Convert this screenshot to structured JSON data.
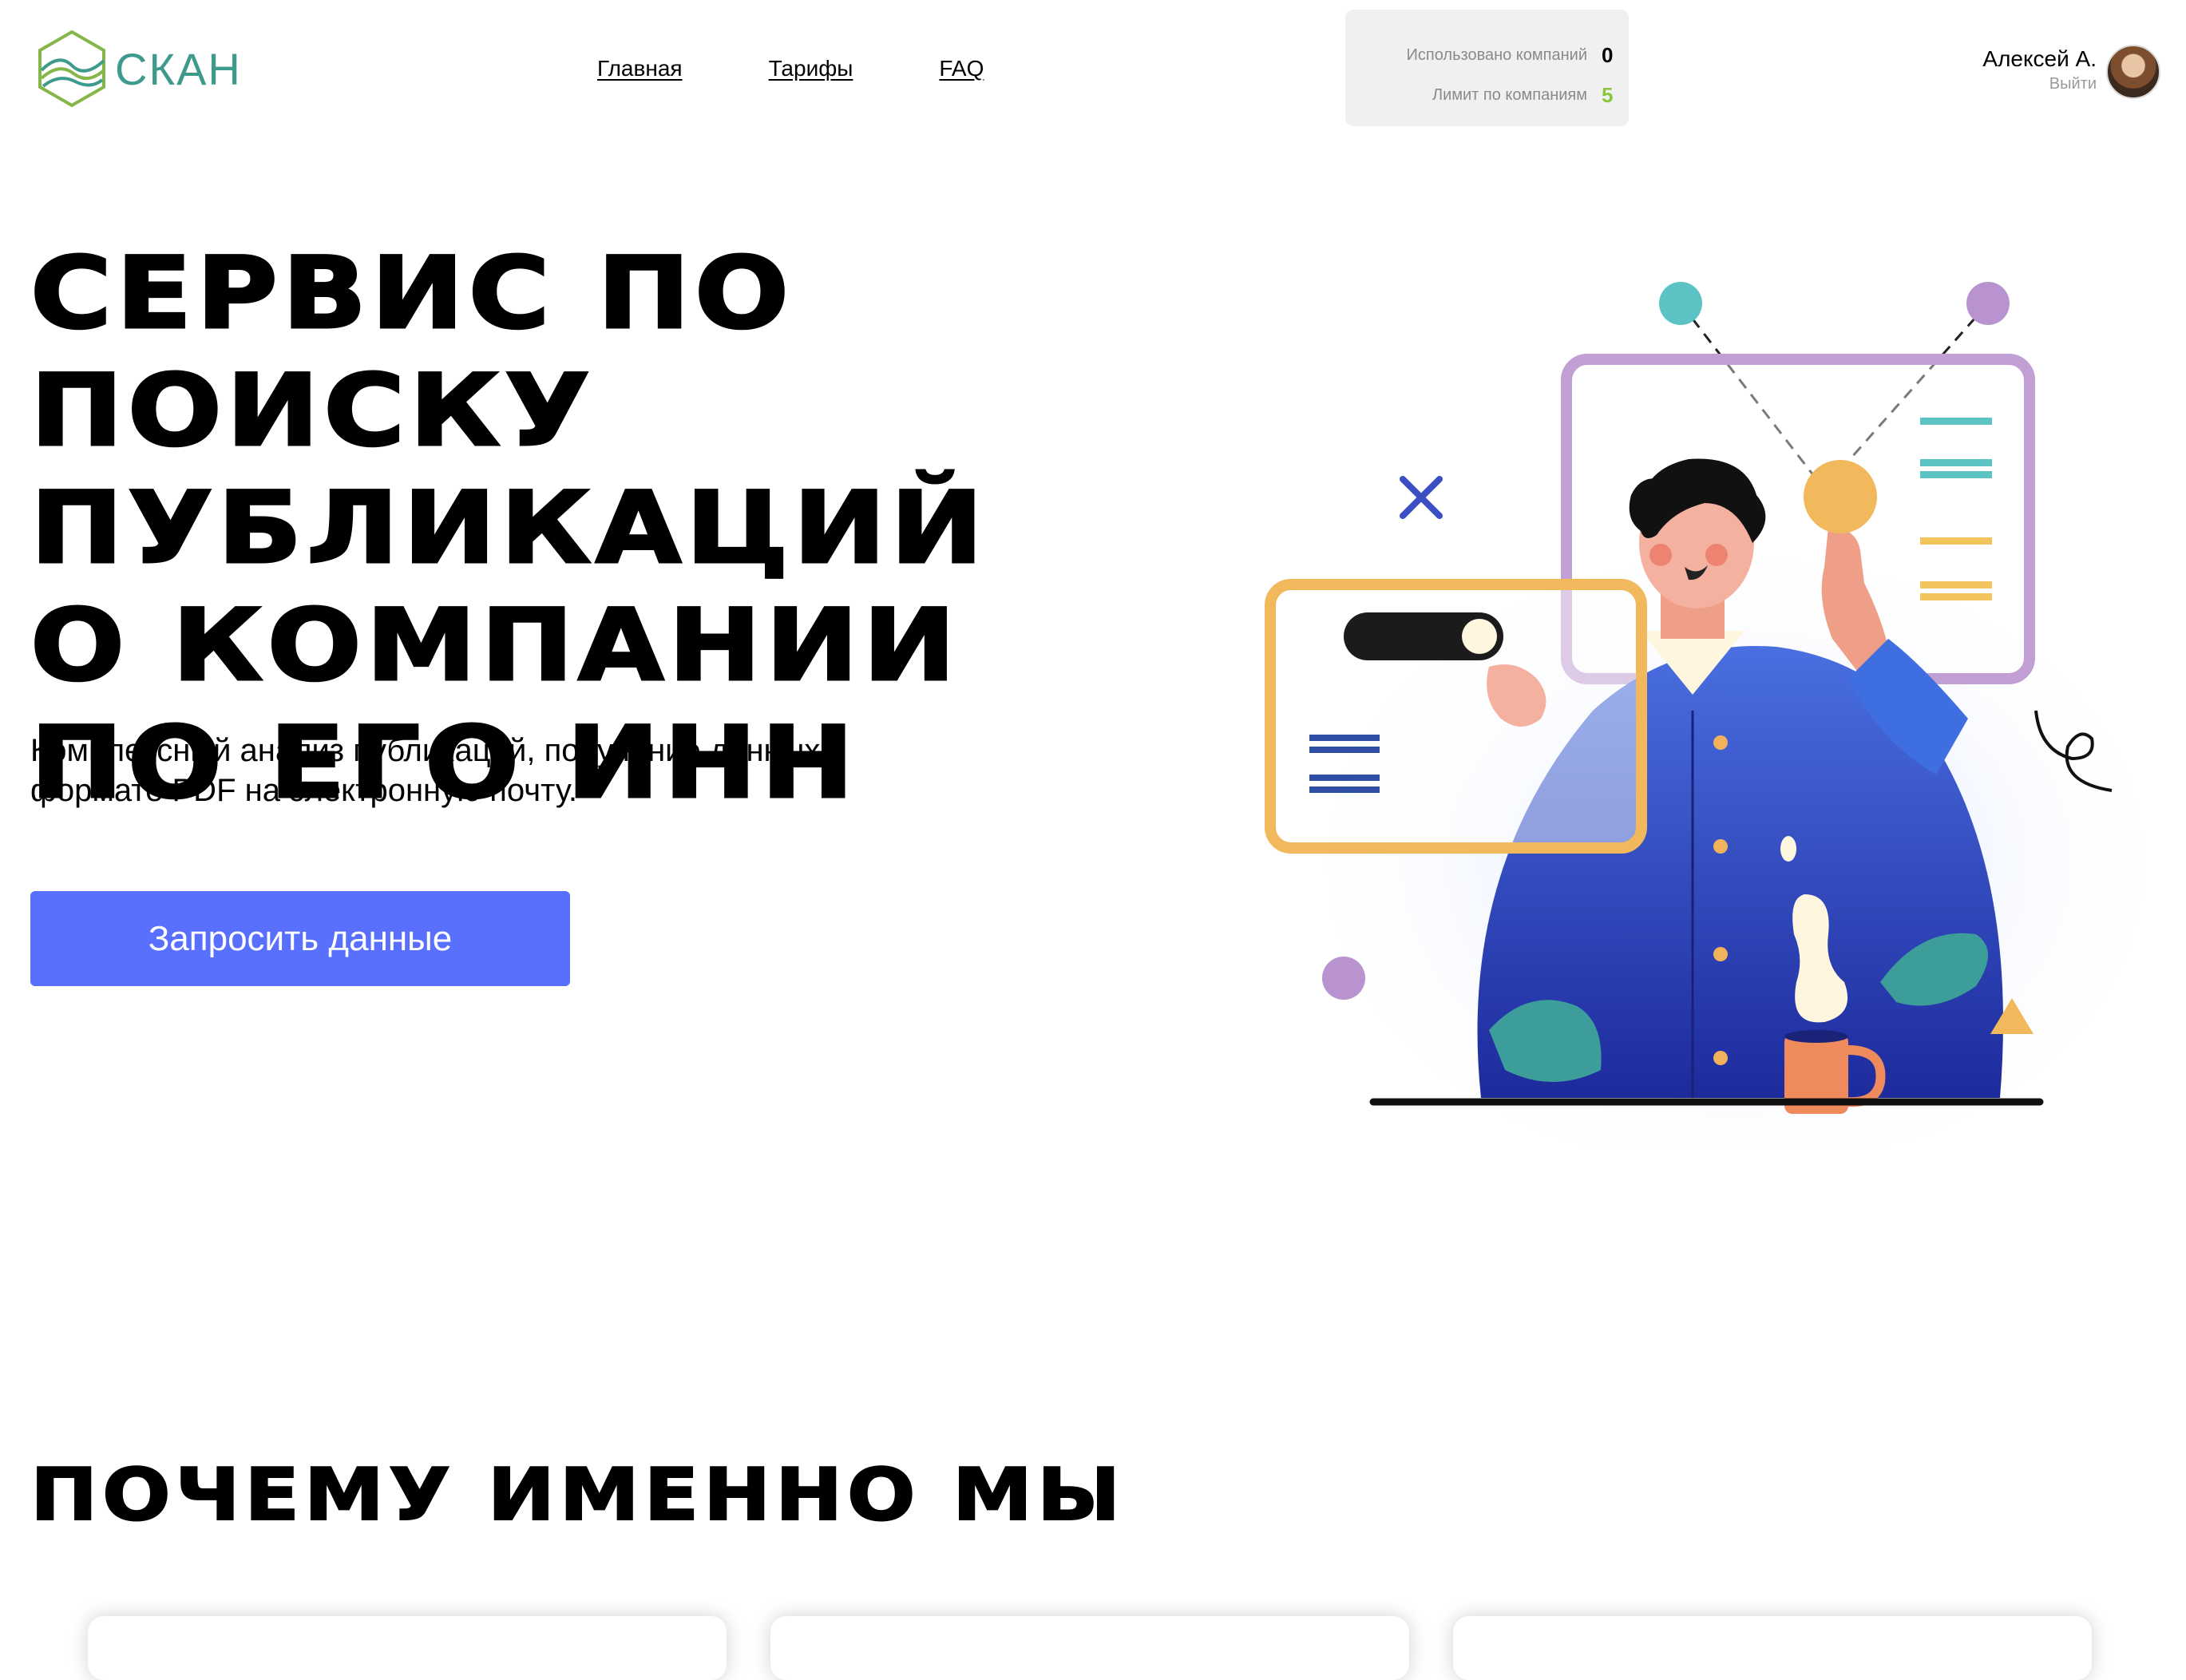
{
  "header": {
    "logo_text": "СКАН",
    "nav": [
      {
        "label": "Главная"
      },
      {
        "label": "Тарифы"
      },
      {
        "label": "FAQ"
      }
    ],
    "stats": {
      "used_label": "Использовано компаний",
      "used_value": "0",
      "limit_label": "Лимит по компаниям",
      "limit_value": "5"
    },
    "user": {
      "name": "Алексей А.",
      "logout_label": "Выйти"
    }
  },
  "hero": {
    "title_lines": [
      "СЕРВИС ПО ПОИСКУ",
      "ПУБЛИКАЦИЙ",
      "О КОМПАНИИ",
      "ПО ЕГО ИНН"
    ],
    "subtitle": "Комплексный анализ публикаций, получение данных в формате PDF на электронную почту.",
    "cta_label": "Запросить данные"
  },
  "why": {
    "title": "ПОЧЕМУ ИМЕННО МЫ"
  },
  "colors": {
    "brand": "#3f9a8e",
    "cta": "#5970ff",
    "limit_value": "#8ac540"
  }
}
